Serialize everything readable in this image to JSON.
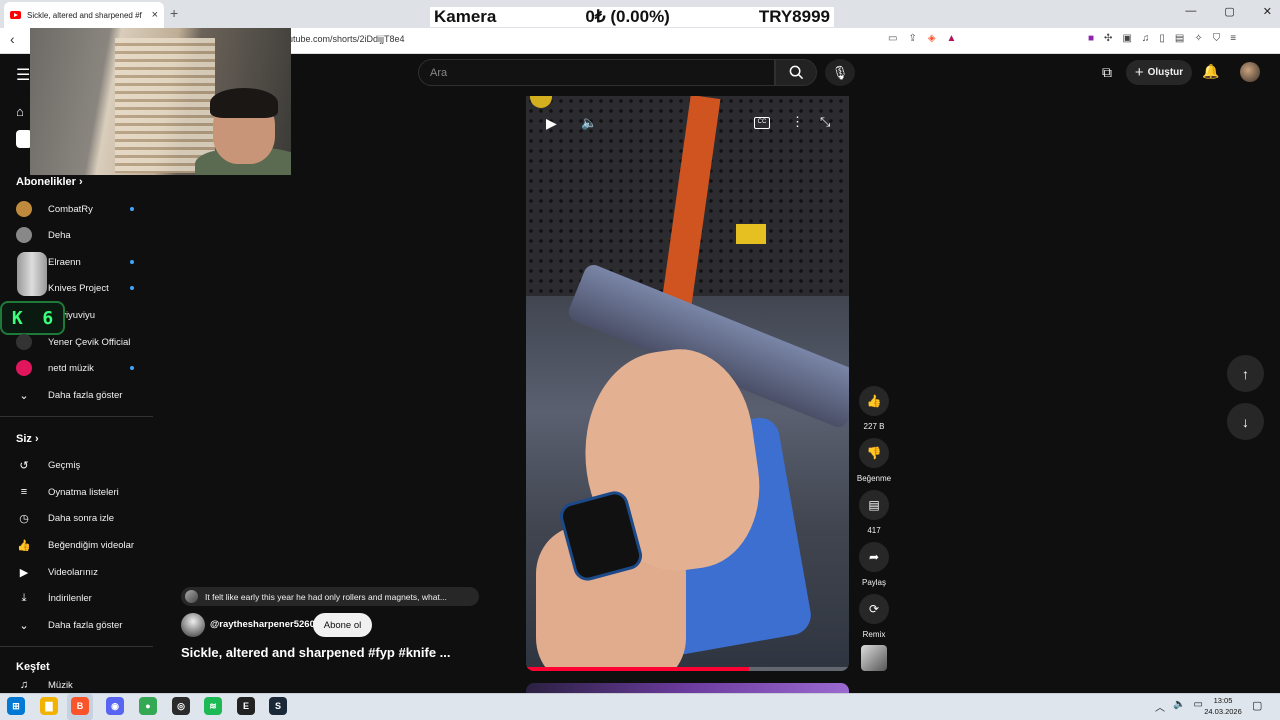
{
  "browser": {
    "tab_title": "Sickle, altered and sharpened #f",
    "new_tab": "+",
    "url": "utube.com/shorts/2iDdijjT8e4",
    "window_controls": [
      "—",
      "▢",
      "✕"
    ]
  },
  "ticker": {
    "label": "Kamera",
    "change": "0₺ (0.00%)",
    "price": "TRY8999"
  },
  "overlay_badge": {
    "letter": "K",
    "number": "6"
  },
  "masthead": {
    "search_placeholder": "Ara",
    "create_label": "Oluştur"
  },
  "sidebar": {
    "subscriptions_header": "Abonelikler",
    "subscriptions": [
      {
        "label": "CombatRy",
        "avatar_color": "#c08a3c",
        "dot": true
      },
      {
        "label": "Deha",
        "avatar_color": "#888888",
        "dot": false
      },
      {
        "label": "Elraenn",
        "avatar_color": "#bbbbbb",
        "dot": true
      },
      {
        "label": "Knives Project",
        "avatar_color": "#555555",
        "dot": true
      },
      {
        "label": "amviyuviyu",
        "avatar_color": "#444444",
        "dot": false
      },
      {
        "label": "Yener Çevik Official",
        "avatar_color": "#333333",
        "dot": false
      },
      {
        "label": "netd müzik",
        "avatar_color": "#e0155b",
        "dot": true
      }
    ],
    "subs_show_more": "Daha fazla göster",
    "you_header": "Siz",
    "you_items": [
      {
        "label": "Geçmiş",
        "icon": "history-icon",
        "glyph": "↺"
      },
      {
        "label": "Oynatma listeleri",
        "icon": "playlists-icon",
        "glyph": "≡"
      },
      {
        "label": "Daha sonra izle",
        "icon": "clock-icon",
        "glyph": "◷"
      },
      {
        "label": "Beğendiğim videolar",
        "icon": "thumbs-up-icon",
        "glyph": "👍"
      },
      {
        "label": "Videolarınız",
        "icon": "your-videos-icon",
        "glyph": "▶"
      },
      {
        "label": "İndirilenler",
        "icon": "download-icon",
        "glyph": "⤓"
      }
    ],
    "you_show_more": "Daha fazla göster",
    "explore_header": "Keşfet",
    "explore_items": [
      {
        "label": "Müzik",
        "icon": "music-icon",
        "glyph": "♫"
      }
    ]
  },
  "short": {
    "comment_preview": "It felt like early this year he had only rollers and magnets, what...",
    "channel": "@raythesharpener5260",
    "subscribe_label": "Abone ol",
    "title": "Sickle, altered and sharpened #fyp #knife ...",
    "progress": 0.69,
    "actions": {
      "likes": "227 B",
      "dislike": "Beğenme",
      "comments": "417",
      "share": "Paylaş",
      "remix": "Remix"
    }
  },
  "taskbar": {
    "date": "24.03.2026",
    "time": "13:05",
    "apps": [
      {
        "name": "start-icon",
        "glyph": "⊞",
        "color": "#0078d4"
      },
      {
        "name": "file-explorer-icon",
        "glyph": "▇",
        "color": "#f2b300"
      },
      {
        "name": "brave-icon",
        "glyph": "B",
        "color": "#fb542b"
      },
      {
        "name": "discord-icon",
        "glyph": "◉",
        "color": "#5865f2"
      },
      {
        "name": "chrome-icon",
        "glyph": "●",
        "color": "#34a853"
      },
      {
        "name": "obs-icon",
        "glyph": "◎",
        "color": "#2b2b2b"
      },
      {
        "name": "spotify-icon",
        "glyph": "≋",
        "color": "#1db954"
      },
      {
        "name": "epic-games-icon",
        "glyph": "E",
        "color": "#222222"
      },
      {
        "name": "steam-icon",
        "glyph": "S",
        "color": "#1b2838"
      }
    ]
  }
}
